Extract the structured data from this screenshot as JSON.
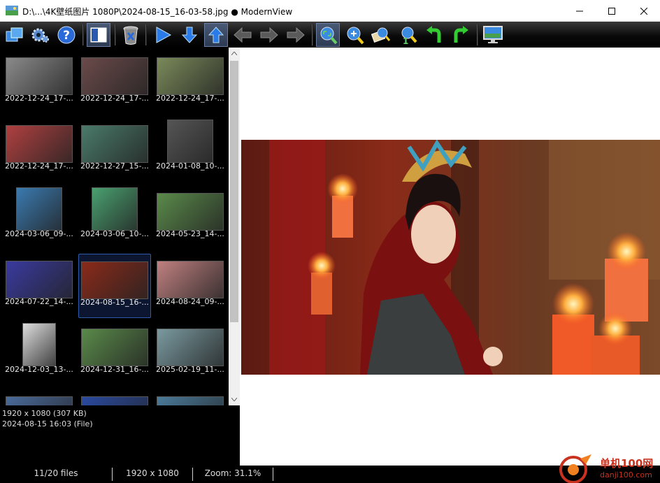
{
  "window": {
    "title": "D:\\...\\4K壁纸图片 1080P\\2024-08-15_16-03-58.jpg ● ModernView",
    "controls": [
      "minimize-icon",
      "maximize-icon",
      "close-icon"
    ]
  },
  "toolbar": {
    "buttons": [
      {
        "icon": "open-folders-icon",
        "active": false
      },
      {
        "icon": "settings-gear-icon",
        "active": false
      },
      {
        "icon": "help-icon",
        "active": false
      },
      {
        "icon": "toggle-panel-icon",
        "active": true
      },
      {
        "icon": "recycle-bin-icon",
        "active": false
      },
      {
        "icon": "play-slideshow-icon",
        "active": false
      },
      {
        "icon": "arrow-down-icon",
        "active": false
      },
      {
        "icon": "arrow-up-icon",
        "active": true
      },
      {
        "icon": "arrow-left-icon",
        "active": false,
        "disabled": true
      },
      {
        "icon": "arrow-right-icon",
        "active": false,
        "disabled": true
      },
      {
        "icon": "arrow-forward-icon",
        "active": false,
        "disabled": true
      },
      {
        "icon": "fit-window-icon",
        "active": true
      },
      {
        "icon": "zoom-in-icon",
        "active": false
      },
      {
        "icon": "zoom-fit-width-icon",
        "active": false
      },
      {
        "icon": "zoom-original-icon",
        "active": false
      },
      {
        "icon": "rotate-left-icon",
        "active": false
      },
      {
        "icon": "rotate-right-icon",
        "active": false
      },
      {
        "icon": "fullscreen-monitor-icon",
        "active": false
      }
    ]
  },
  "thumbnails": [
    {
      "caption": "2022-12-24_17-...",
      "tone": "#8a8a8a",
      "shape": "wide"
    },
    {
      "caption": "2022-12-24_17-...",
      "tone": "#6b4a4a",
      "shape": "wide"
    },
    {
      "caption": "2022-12-24_17-...",
      "tone": "#7a8a5a",
      "shape": "wide"
    },
    {
      "caption": "2022-12-24_17-...",
      "tone": "#b04040",
      "shape": "wide"
    },
    {
      "caption": "2022-12-27_15-...",
      "tone": "#4a7a6a",
      "shape": "wide"
    },
    {
      "caption": "2024-01-08_10-...",
      "tone": "#555555",
      "shape": "square"
    },
    {
      "caption": "2024-03-06_09-...",
      "tone": "#3a7ab0",
      "shape": "square"
    },
    {
      "caption": "2024-03-06_10-...",
      "tone": "#4aa070",
      "shape": "square"
    },
    {
      "caption": "2024-05-23_14-...",
      "tone": "#5a8a4a",
      "shape": "wide"
    },
    {
      "caption": "2024-07-22_14-...",
      "tone": "#3a3aa0",
      "shape": "wide"
    },
    {
      "caption": "2024-08-15_16-...",
      "tone": "#8a2a1a",
      "shape": "wide",
      "selected": true
    },
    {
      "caption": "2024-08-24_09-...",
      "tone": "#c08080",
      "shape": "wide"
    },
    {
      "caption": "2024-12-03_13-...",
      "tone": "#ddd",
      "shape": "portrait"
    },
    {
      "caption": "2024-12-31_16-...",
      "tone": "#5a8a4a",
      "shape": "wide"
    },
    {
      "caption": "2025-02-19_11-...",
      "tone": "#7a9aa0",
      "shape": "wide"
    },
    {
      "caption": "",
      "tone": "#4a6a9a",
      "shape": "wide"
    },
    {
      "caption": "",
      "tone": "#2a4aa0",
      "shape": "wide"
    },
    {
      "caption": "",
      "tone": "#4a7a9a",
      "shape": "wide"
    }
  ],
  "info": {
    "line1": "1920 x 1080 (307 KB)",
    "line2": "2024-08-15 16:03 (File)"
  },
  "status": {
    "files": "11/20 files",
    "dimensions": "1920 x 1080",
    "zoom": "Zoom: 31.1%"
  },
  "watermark": {
    "line1": "单机100网",
    "line2": "danji100.com"
  }
}
